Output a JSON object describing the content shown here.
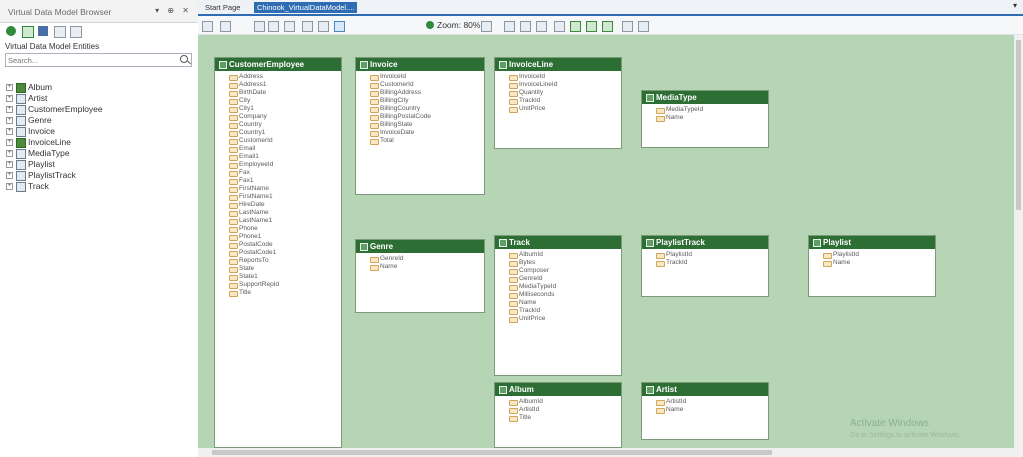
{
  "left_panel": {
    "title": "Virtual Data Model Browser",
    "title_buttons": "▾ ⊕ ✕",
    "subtitle": "Virtual Data Model Entities",
    "search_placeholder": "Search...",
    "tree": [
      {
        "label": "Album",
        "selected": true
      },
      {
        "label": "Artist",
        "selected": false
      },
      {
        "label": "CustomerEmployee",
        "selected": false
      },
      {
        "label": "Genre",
        "selected": false
      },
      {
        "label": "Invoice",
        "selected": false
      },
      {
        "label": "InvoiceLine",
        "selected": true
      },
      {
        "label": "MediaType",
        "selected": false
      },
      {
        "label": "Playlist",
        "selected": false
      },
      {
        "label": "PlaylistTrack",
        "selected": false
      },
      {
        "label": "Track",
        "selected": false
      }
    ]
  },
  "tabs": {
    "start": "Start Page",
    "model": "Chinook_VirtualDataModel....",
    "more": "▾"
  },
  "toolbar": {
    "zoom_label": "Zoom: 80%"
  },
  "entities": {
    "customer_employee": {
      "title": "CustomerEmployee",
      "fields": [
        "Address",
        "Address1",
        "BirthDate",
        "City",
        "City1",
        "Company",
        "Country",
        "Country1",
        "CustomerId",
        "Email",
        "Email1",
        "EmployeeId",
        "Fax",
        "Fax1",
        "FirstName",
        "FirstName1",
        "HireDate",
        "LastName",
        "LastName1",
        "Phone",
        "Phone1",
        "PostalCode",
        "PostalCode1",
        "ReportsTo",
        "State",
        "State1",
        "SupportRepId",
        "Title"
      ]
    },
    "invoice": {
      "title": "Invoice",
      "fields": [
        "InvoiceId",
        "CustomerId",
        "BillingAddress",
        "BillingCity",
        "BillingCountry",
        "BillingPostalCode",
        "BillingState",
        "InvoiceDate",
        "Total"
      ]
    },
    "invoice_line": {
      "title": "InvoiceLine",
      "fields": [
        "InvoiceId",
        "InvoiceLineId",
        "Quantity",
        "TrackId",
        "UnitPrice"
      ]
    },
    "media_type": {
      "title": "MediaType",
      "fields": [
        "MediaTypeId",
        "Name"
      ]
    },
    "genre": {
      "title": "Genre",
      "fields": [
        "GenreId",
        "Name"
      ]
    },
    "track": {
      "title": "Track",
      "fields": [
        "AlbumId",
        "Bytes",
        "Composer",
        "GenreId",
        "MediaTypeId",
        "Milliseconds",
        "Name",
        "TrackId",
        "UnitPrice"
      ]
    },
    "playlist_track": {
      "title": "PlaylistTrack",
      "fields": [
        "PlaylistId",
        "TrackId"
      ]
    },
    "playlist": {
      "title": "Playlist",
      "fields": [
        "PlaylistId",
        "Name"
      ]
    },
    "album": {
      "title": "Album",
      "fields": [
        "AlbumId",
        "ArtistId",
        "Title"
      ]
    },
    "artist": {
      "title": "Artist",
      "fields": [
        "ArtistId",
        "Name"
      ]
    }
  },
  "watermark": {
    "line1": "Activate Windows",
    "line2": "Go to Settings to activate Windows."
  },
  "colors": {
    "entity_header": "#2d6e35",
    "canvas": "#b5d5b5",
    "active_tab": "#2e6db4"
  }
}
